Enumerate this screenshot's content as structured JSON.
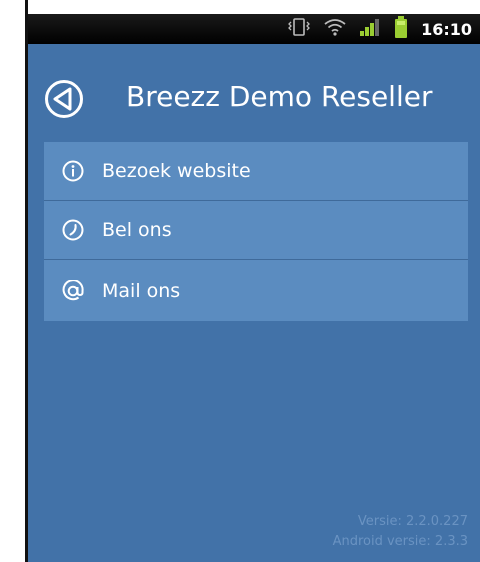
{
  "statusbar": {
    "time": "16:10",
    "icons": [
      "vibrate-icon",
      "wifi-icon",
      "signal-icon",
      "battery-icon"
    ]
  },
  "header": {
    "title": "Breezz Demo Reseller",
    "back_icon": "back-arrow-icon"
  },
  "menu": {
    "items": [
      {
        "label": "Bezoek website",
        "icon": "info-icon"
      },
      {
        "label": "Bel ons",
        "icon": "phone-icon"
      },
      {
        "label": "Mail ons",
        "icon": "at-icon"
      }
    ]
  },
  "footer": {
    "version": "Versie: 2.2.0.227",
    "android_version": "Android versie: 2.3.3"
  },
  "colors": {
    "background": "#4272a8",
    "menu_item": "#5b8cc0",
    "battery": "#9acd32"
  }
}
